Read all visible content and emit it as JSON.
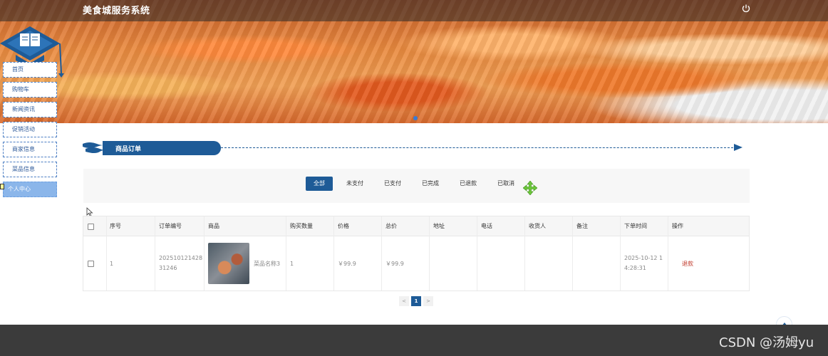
{
  "header": {
    "site_title": "美食城服务系统"
  },
  "sidebar": {
    "items": [
      {
        "label": "首页"
      },
      {
        "label": "购物车"
      },
      {
        "label": "新闻资讯"
      },
      {
        "label": "促销活动"
      },
      {
        "label": "商家信息"
      },
      {
        "label": "菜品信息"
      },
      {
        "label": "个人中心",
        "active": true
      }
    ]
  },
  "section": {
    "title": "商品订单"
  },
  "tabs": [
    {
      "label": "全部",
      "active": true
    },
    {
      "label": "未支付"
    },
    {
      "label": "已支付"
    },
    {
      "label": "已完成"
    },
    {
      "label": "已退款"
    },
    {
      "label": "已取消"
    }
  ],
  "table": {
    "headers": [
      "序号",
      "订单编号",
      "商品",
      "购买数量",
      "价格",
      "总价",
      "地址",
      "电话",
      "收货人",
      "备注",
      "下单时间",
      "操作"
    ],
    "rows": [
      {
        "index": "1",
        "order_no": "20251012142831246",
        "product": "菜品名称3",
        "quantity": "1",
        "price": "￥99.9",
        "total": "￥99.9",
        "address": "",
        "phone": "",
        "receiver": "",
        "remark": "",
        "order_time": "2025-10-12 14:28:31",
        "action": "退款"
      }
    ]
  },
  "pagination": {
    "prev": "<",
    "current": "1",
    "next": ">"
  },
  "footer": {
    "watermark": "CSDN @汤姆yu"
  },
  "colors": {
    "primary": "#1e5b97",
    "refund": "#c0392b",
    "footer": "#3b3b3b"
  }
}
